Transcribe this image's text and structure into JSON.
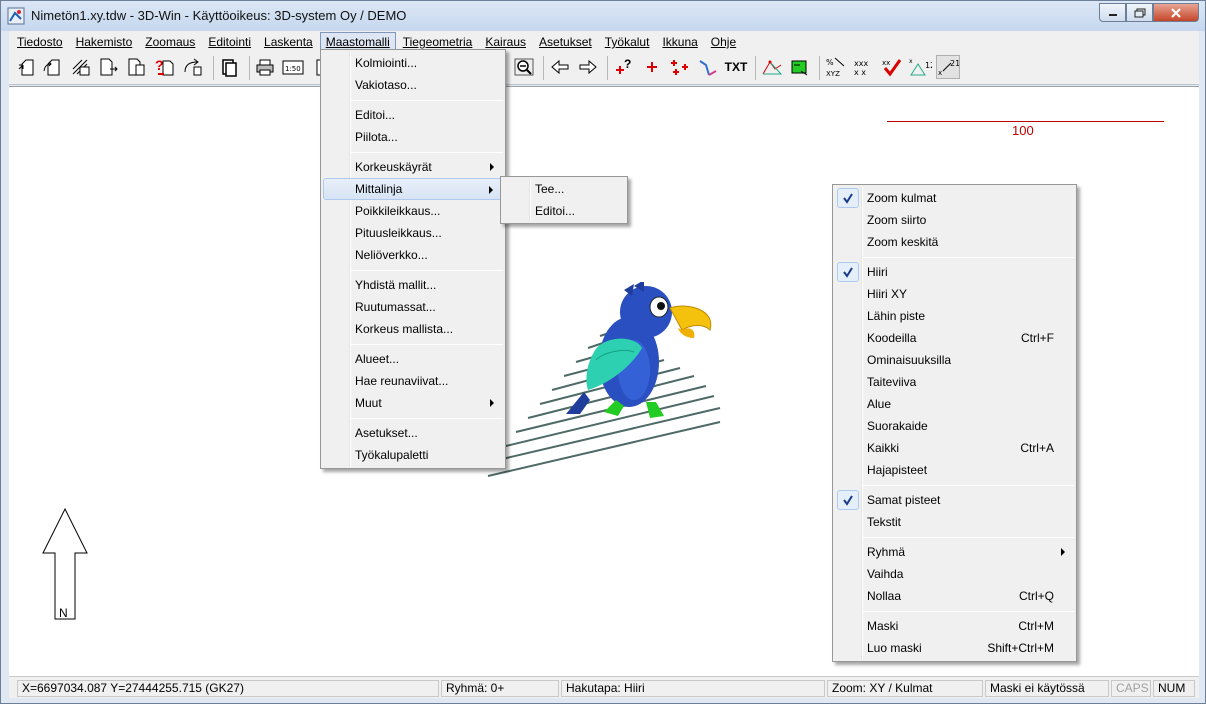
{
  "window": {
    "title": "Nimetön1.xy.tdw - 3D-Win - Käyttöoikeus: 3D-system Oy / DEMO"
  },
  "menubar": [
    {
      "label": "Tiedosto"
    },
    {
      "label": "Hakemisto"
    },
    {
      "label": "Zoomaus"
    },
    {
      "label": "Editointi"
    },
    {
      "label": "Laskenta"
    },
    {
      "label": "Maastomalli"
    },
    {
      "label": "Tiegeometria"
    },
    {
      "label": "Kairaus"
    },
    {
      "label": "Asetukset"
    },
    {
      "label": "Työkalut"
    },
    {
      "label": "Ikkuna"
    },
    {
      "label": "Ohje"
    }
  ],
  "toolbar": {
    "text_button": "TXT",
    "scale_button": "1:50",
    "point_badge": "12",
    "point_badge2": "21"
  },
  "canvas": {
    "scale_label": "100",
    "north_label": "N"
  },
  "maastomalli_menu": [
    {
      "label": "Kolmiointi..."
    },
    {
      "label": "Vakiotaso..."
    },
    {
      "label": "Editoi..."
    },
    {
      "label": "Piilota..."
    },
    {
      "label": "Korkeuskäyrät"
    },
    {
      "label": "Mittalinja"
    },
    {
      "label": "Poikkileikkaus..."
    },
    {
      "label": "Pituusleikkaus..."
    },
    {
      "label": "Neliöverkko..."
    },
    {
      "label": "Yhdistä mallit..."
    },
    {
      "label": "Ruutumassat..."
    },
    {
      "label": "Korkeus mallista..."
    },
    {
      "label": "Alueet..."
    },
    {
      "label": "Hae reunaviivat..."
    },
    {
      "label": "Muut"
    },
    {
      "label": "Asetukset..."
    },
    {
      "label": "Työkalupaletti"
    }
  ],
  "mittalinja_submenu": [
    {
      "label": "Tee..."
    },
    {
      "label": "Editoi..."
    }
  ],
  "context_menu": [
    {
      "label": "Zoom kulmat",
      "shortcut": ""
    },
    {
      "label": "Zoom siirto",
      "shortcut": ""
    },
    {
      "label": "Zoom keskitä",
      "shortcut": ""
    },
    {
      "label": "Hiiri",
      "shortcut": ""
    },
    {
      "label": "Hiiri XY",
      "shortcut": ""
    },
    {
      "label": "Lähin piste",
      "shortcut": ""
    },
    {
      "label": "Koodeilla",
      "shortcut": "Ctrl+F"
    },
    {
      "label": "Ominaisuuksilla",
      "shortcut": ""
    },
    {
      "label": "Taiteviiva",
      "shortcut": ""
    },
    {
      "label": "Alue",
      "shortcut": ""
    },
    {
      "label": "Suorakaide",
      "shortcut": ""
    },
    {
      "label": "Kaikki",
      "shortcut": "Ctrl+A"
    },
    {
      "label": "Hajapisteet",
      "shortcut": ""
    },
    {
      "label": "Samat pisteet",
      "shortcut": ""
    },
    {
      "label": "Tekstit",
      "shortcut": ""
    },
    {
      "label": "Ryhmä",
      "shortcut": ""
    },
    {
      "label": "Vaihda",
      "shortcut": ""
    },
    {
      "label": "Nollaa",
      "shortcut": "Ctrl+Q"
    },
    {
      "label": "Maski",
      "shortcut": "Ctrl+M"
    },
    {
      "label": "Luo maski",
      "shortcut": "Shift+Ctrl+M"
    }
  ],
  "statusbar": {
    "coords": "X=6697034.087  Y=27444255.715   (GK27)",
    "group": "Ryhmä: 0+",
    "search_mode": "Hakutapa: Hiiri",
    "zoom_mode": "Zoom: XY  /  Kulmat",
    "mask": "Maski ei käytössä",
    "caps": "CAPS",
    "num": "NUM"
  },
  "colors": {
    "scale_red": "#c00000",
    "menu_highlight": "#aecaf0"
  }
}
